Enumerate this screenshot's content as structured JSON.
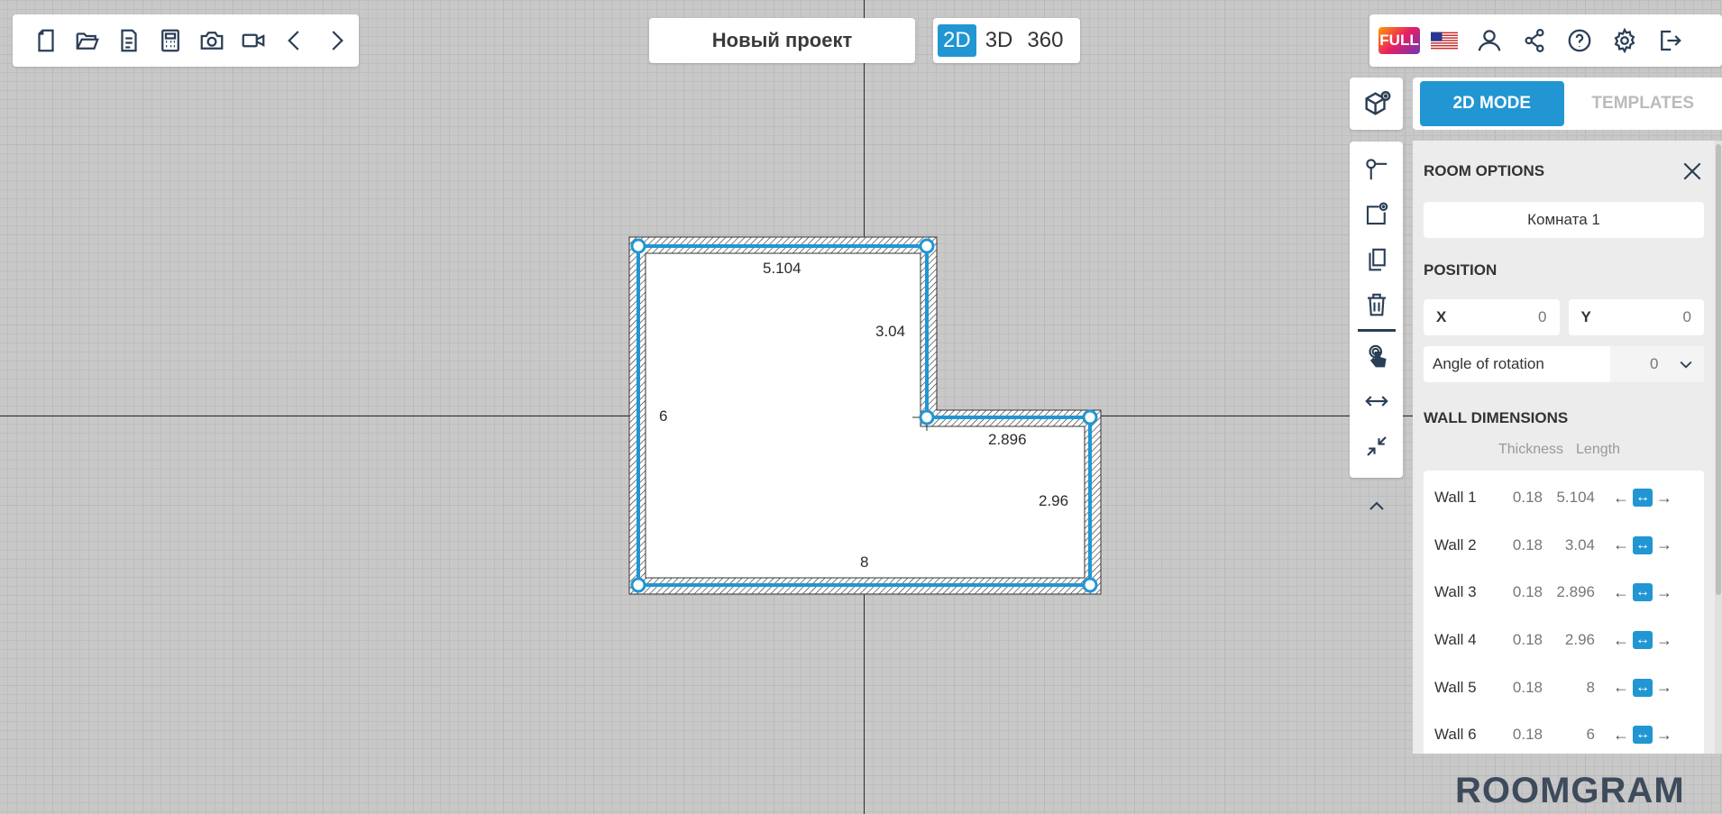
{
  "toolbar": {
    "left_icons": [
      "new-file-icon",
      "open-folder-icon",
      "document-icon",
      "calculator-icon",
      "camera-icon",
      "video-icon",
      "undo-icon",
      "redo-icon"
    ],
    "project_title": "Новый проект",
    "modes": [
      {
        "label": "2D",
        "active": true
      },
      {
        "label": "3D",
        "active": false
      },
      {
        "label": "360",
        "active": false
      }
    ],
    "full_badge": "FULL",
    "right_icons": [
      "us-flag-icon",
      "user-icon",
      "share-icon",
      "help-icon",
      "settings-icon",
      "logout-icon"
    ]
  },
  "tabs": [
    {
      "label": "2D MODE",
      "active": true
    },
    {
      "label": "TEMPLATES",
      "active": false
    }
  ],
  "room_options": {
    "title": "ROOM OPTIONS",
    "room_name": "Комната 1",
    "position_title": "POSITION",
    "x_label": "X",
    "x_value": "0",
    "y_label": "Y",
    "y_value": "0",
    "angle_label": "Angle of rotation",
    "angle_value": "0",
    "wall_dimensions_title": "WALL DIMENSIONS",
    "thickness_header": "Thickness",
    "length_header": "Length",
    "walls": [
      {
        "name": "Wall 1",
        "thickness": "0.18",
        "length": "5.104"
      },
      {
        "name": "Wall 2",
        "thickness": "0.18",
        "length": "3.04"
      },
      {
        "name": "Wall 3",
        "thickness": "0.18",
        "length": "2.896"
      },
      {
        "name": "Wall 4",
        "thickness": "0.18",
        "length": "2.96"
      },
      {
        "name": "Wall 5",
        "thickness": "0.18",
        "length": "8"
      },
      {
        "name": "Wall 6",
        "thickness": "0.18",
        "length": "6"
      }
    ]
  },
  "plan": {
    "dimensions": {
      "top": "5.104",
      "inner_vertical": "3.04",
      "left": "6",
      "inner_horizontal": "2.896",
      "right": "2.96",
      "bottom": "8"
    },
    "accent_color": "#2196d3"
  },
  "logo_text": "ROOMGRAM"
}
